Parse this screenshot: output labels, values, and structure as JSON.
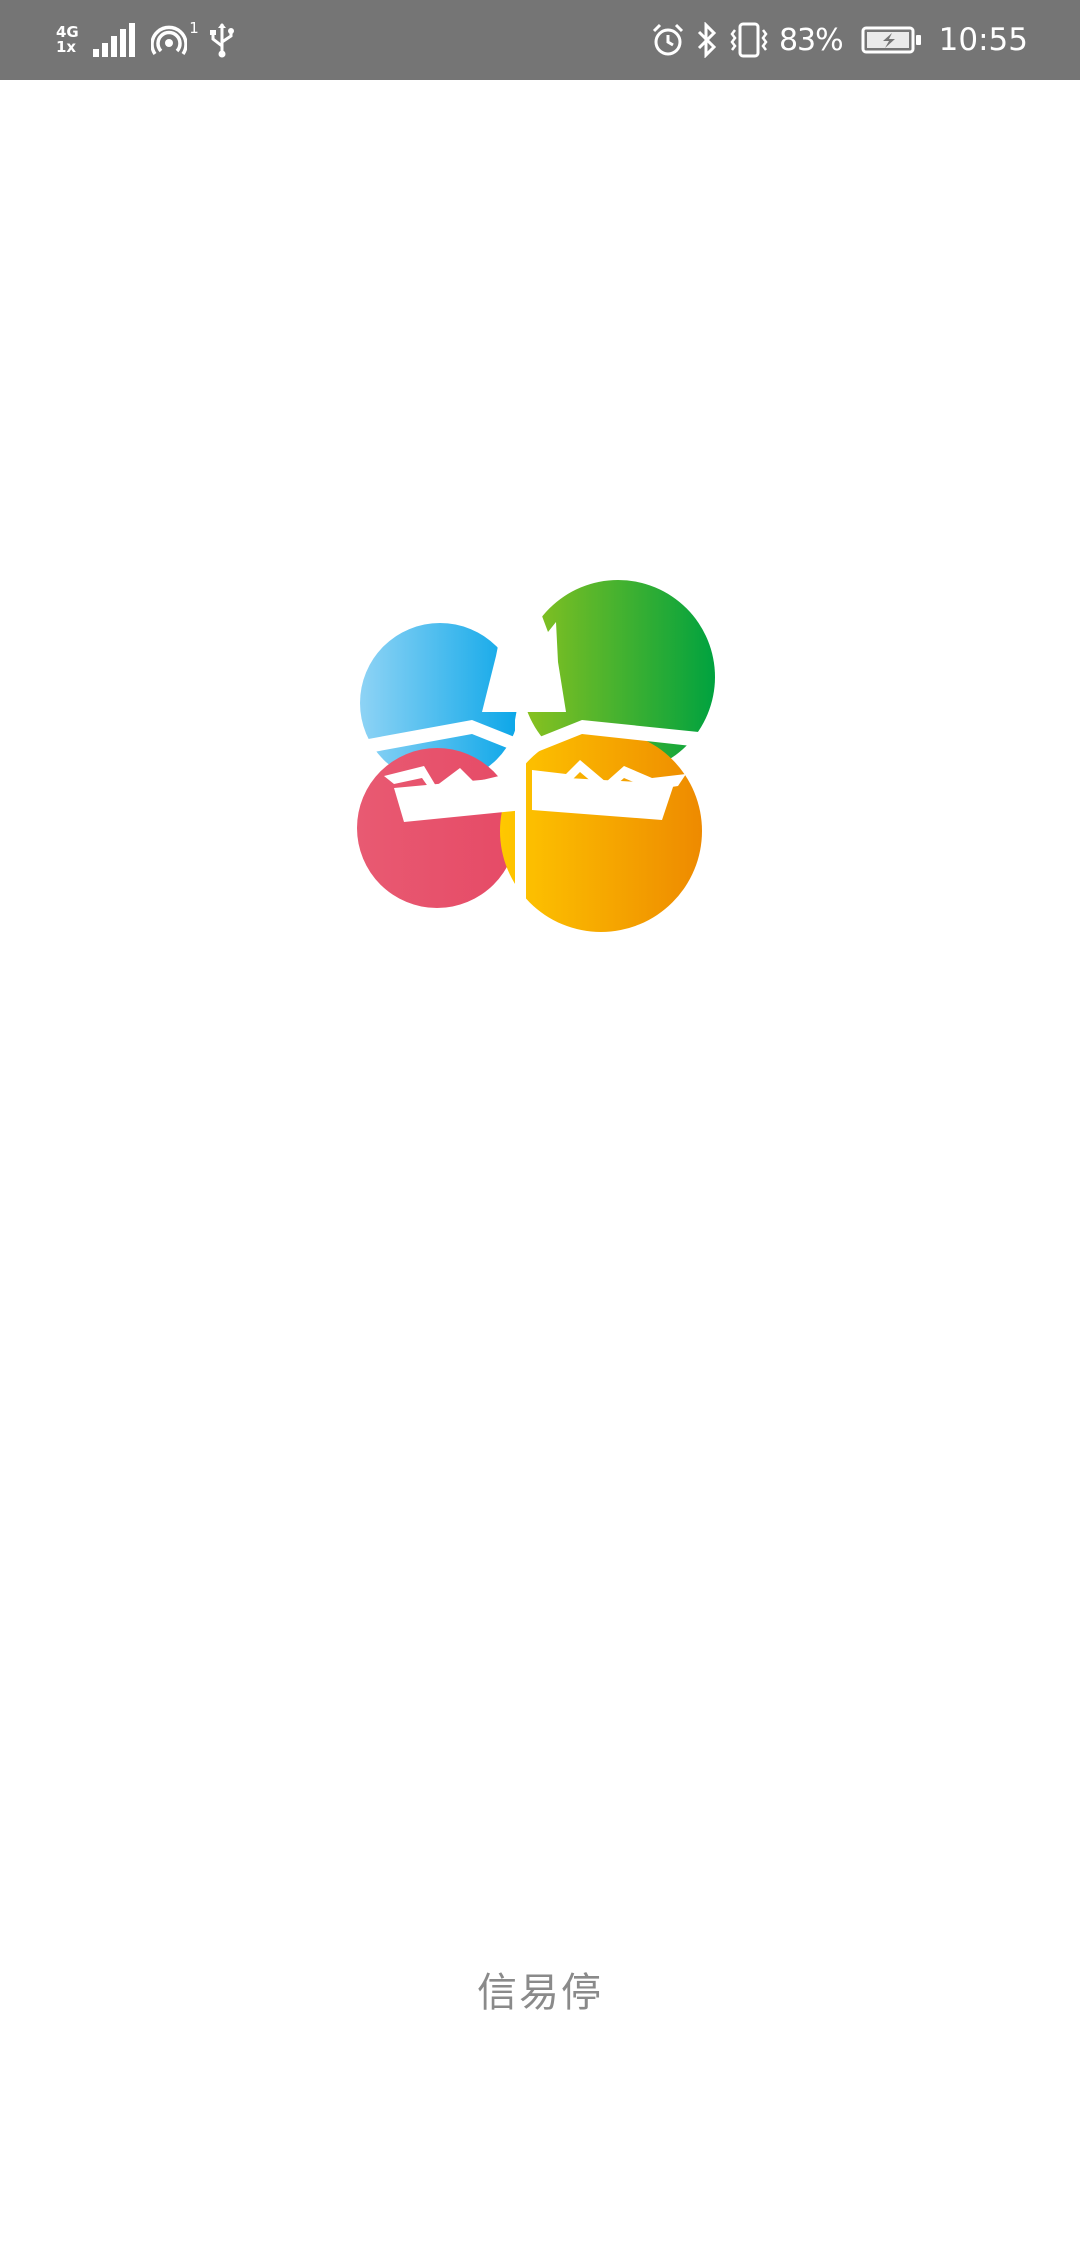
{
  "status_bar": {
    "network_type": "4G",
    "network_sub": "1x",
    "hotspot_count": "1",
    "battery_percent": "83%",
    "time": "10:55"
  },
  "splash": {
    "app_name": "信易停"
  },
  "colors": {
    "status_bar_bg": "#757575",
    "logo_blue": "#1AAFEA",
    "logo_green": "#3AA935",
    "logo_red": "#E9546B",
    "logo_orange": "#F39800",
    "app_name_text": "#8A8A8A"
  },
  "icons": {
    "signal": "signal-bars-icon",
    "hotspot": "hotspot-icon",
    "usb": "usb-icon",
    "alarm": "alarm-icon",
    "bluetooth": "bluetooth-icon",
    "vibrate": "vibrate-icon",
    "battery": "battery-charging-icon"
  }
}
